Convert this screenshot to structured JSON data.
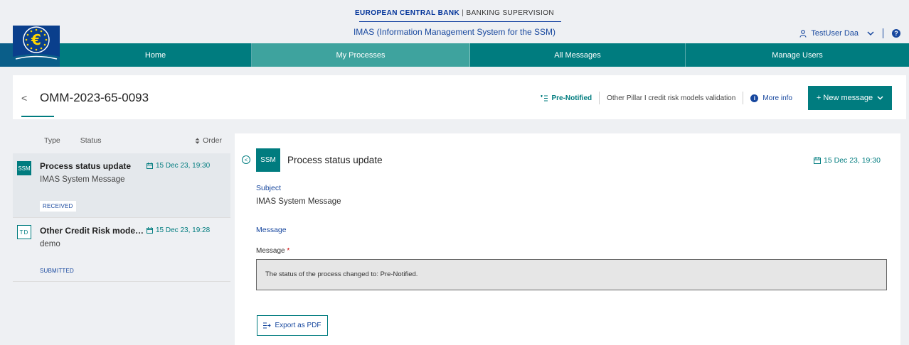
{
  "brand": {
    "org": "EUROPEAN CENTRAL BANK",
    "divider": "|",
    "division": "BANKING SUPERVISION",
    "app_title": "IMAS (Information Management System for the SSM)",
    "logo_icon": "euro-logo-icon"
  },
  "user": {
    "name": "TestUser Daa",
    "separator": "|",
    "help_glyph": "?",
    "user_icon": "user-icon",
    "caret_icon": "chevron-down-icon"
  },
  "nav": {
    "items": [
      "Home",
      "My Processes",
      "All Messages",
      "Manage Users"
    ],
    "active": "My Processes"
  },
  "header": {
    "back_glyph": "<",
    "process_id": "OMM-2023-65-0093",
    "status": "Pre-Notified",
    "process_type": "Other Pillar I credit risk models validation",
    "more_info": "More info",
    "info_glyph": "i",
    "new_message": "+ New message"
  },
  "list": {
    "col_type": "Type",
    "col_status": "Status",
    "order": "Order",
    "items": [
      {
        "badge": "SSM",
        "title": "Process status update",
        "date": "15 Dec 23, 19:30",
        "subtitle": "IMAS System Message",
        "tag": "RECEIVED"
      },
      {
        "badge": "TD",
        "title": "Other Credit Risk models ...",
        "date": "15 Dec 23, 19:28",
        "subtitle": "demo",
        "tag": "SUBMITTED"
      }
    ]
  },
  "detail": {
    "collapse_glyph": "<",
    "badge": "SSM",
    "title": "Process status update",
    "date": "15 Dec 23, 19:30",
    "subject_label": "Subject",
    "subject_value": "IMAS System Message",
    "message_section_label": "Message",
    "message_label": "Message",
    "required_mark": "*",
    "message_body": "The status of the process changed to: Pre-Notified.",
    "export_label": "Export as PDF"
  },
  "colors": {
    "teal": "#007c7f",
    "navy": "#17479e",
    "nav_active": "#3ea39e"
  }
}
